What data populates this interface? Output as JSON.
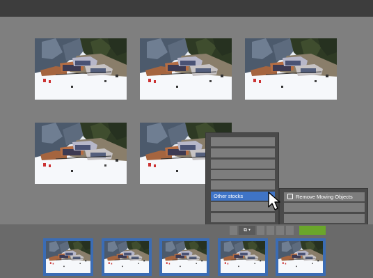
{
  "menu": {
    "items": [
      {
        "label": ""
      },
      {
        "label": ""
      },
      {
        "label": ""
      },
      {
        "label": ""
      },
      {
        "label": ""
      },
      {
        "label": "Other stocks"
      },
      {
        "label": ""
      },
      {
        "label": ""
      }
    ],
    "active_index": 5
  },
  "submenu": {
    "items": [
      {
        "label": "Remove Moving Objects",
        "icon": "remove-moving-objects-icon"
      },
      {
        "label": ""
      },
      {
        "label": ""
      }
    ]
  },
  "toolbar": {
    "dropdown_glyph": "⧉ ▾"
  },
  "photos": {
    "count": 5,
    "subject": "ski-resort-mountain-scene"
  },
  "thumbnails": {
    "count": 5,
    "selected": "all"
  },
  "colors": {
    "selection_blue": "#3f74c6",
    "accent_green": "#6aa62b",
    "topbar": "#3d3d3d"
  }
}
